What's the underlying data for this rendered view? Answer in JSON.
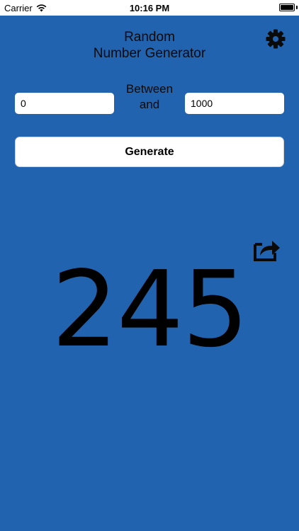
{
  "status_bar": {
    "carrier": "Carrier",
    "time": "10:16 PM",
    "wifi_icon": "wifi-icon",
    "battery_icon": "battery-icon"
  },
  "header": {
    "title_line1": "Random",
    "title_line2": "Number Generator",
    "settings_icon": "gear-icon"
  },
  "range": {
    "min_value": "0",
    "between_line1": "Between",
    "between_line2": "and",
    "max_value": "1000"
  },
  "actions": {
    "generate_label": "Generate",
    "share_icon": "share-icon"
  },
  "result": {
    "value": "245"
  },
  "colors": {
    "background": "#2163ae",
    "text": "#0a0a0a",
    "field": "#ffffff"
  }
}
